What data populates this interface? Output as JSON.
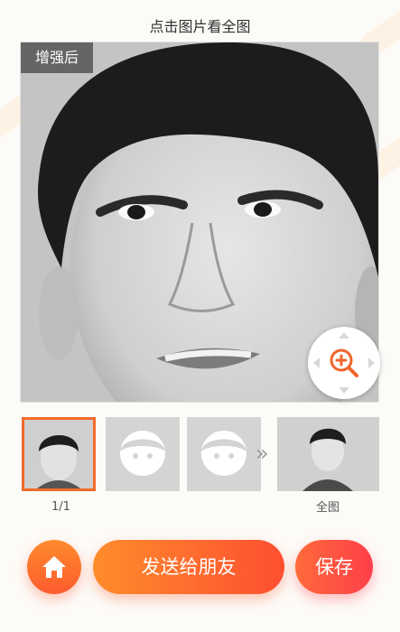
{
  "header": {
    "hint": "点击图片看全图"
  },
  "preview": {
    "badge": "增强后",
    "zoom_icon": "zoom-in-icon"
  },
  "thumbnails": {
    "counter": "1/1",
    "full_label": "全图",
    "placeholder_icon": "face-placeholder-icon",
    "more_icon": "double-chevron-right-icon"
  },
  "actions": {
    "home_icon": "home-icon",
    "send_label": "发送给朋友",
    "save_label": "保存"
  },
  "colors": {
    "accent": "#f26b2a",
    "button_orange": "#fd5c2f",
    "button_red": "#fe3f4a"
  }
}
